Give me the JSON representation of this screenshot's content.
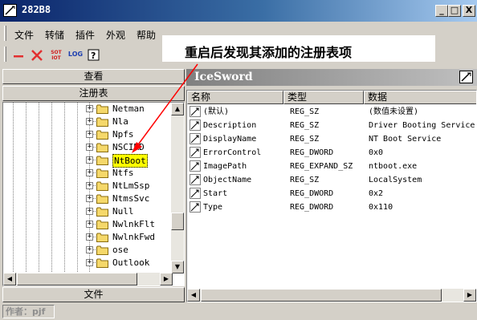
{
  "window": {
    "title": "282B8",
    "minimize": "_",
    "maximize": "□",
    "close": "X"
  },
  "menu": [
    "文件",
    "转储",
    "插件",
    "外观",
    "帮助"
  ],
  "toolbar": {
    "minus_icon": "minus-icon",
    "close_icon": "x-icon",
    "swap_label_top": "SOT",
    "swap_label_bottom": "IOT",
    "log_label": "LOG",
    "help_icon": "help-icon"
  },
  "left": {
    "view_button": "查看",
    "registry_button": "注册表",
    "tree": [
      {
        "label": "Netman"
      },
      {
        "label": "Nla"
      },
      {
        "label": "Npfs"
      },
      {
        "label": "NSCIRD"
      },
      {
        "label": "NtBoot",
        "selected": true
      },
      {
        "label": "Ntfs"
      },
      {
        "label": "NtLmSsp"
      },
      {
        "label": "NtmsSvc"
      },
      {
        "label": "Null"
      },
      {
        "label": "NwlnkFlt"
      },
      {
        "label": "NwlnkFwd"
      },
      {
        "label": "ose"
      },
      {
        "label": "Outlook"
      }
    ],
    "file_button": "文件"
  },
  "right": {
    "header_title": "IceSword",
    "columns": [
      "名称",
      "类型",
      "数据"
    ],
    "rows": [
      {
        "name": "(默认)",
        "type": "REG_SZ",
        "data": "(数值未设置)"
      },
      {
        "name": "Description",
        "type": "REG_SZ",
        "data": "Driver Booting Service"
      },
      {
        "name": "DisplayName",
        "type": "REG_SZ",
        "data": "NT Boot Service"
      },
      {
        "name": "ErrorControl",
        "type": "REG_DWORD",
        "data": "0x0"
      },
      {
        "name": "ImagePath",
        "type": "REG_EXPAND_SZ",
        "data": "ntboot.exe"
      },
      {
        "name": "ObjectName",
        "type": "REG_SZ",
        "data": "LocalSystem"
      },
      {
        "name": "Start",
        "type": "REG_DWORD",
        "data": "0x2"
      },
      {
        "name": "Type",
        "type": "REG_DWORD",
        "data": "0x110"
      }
    ]
  },
  "status": "作者：pjf",
  "annotation": "重启后发现其添加的注册表项",
  "colors": {
    "highlight": "#ffff00",
    "arrow": "#ff0000",
    "title_bar": "#0a246a"
  }
}
